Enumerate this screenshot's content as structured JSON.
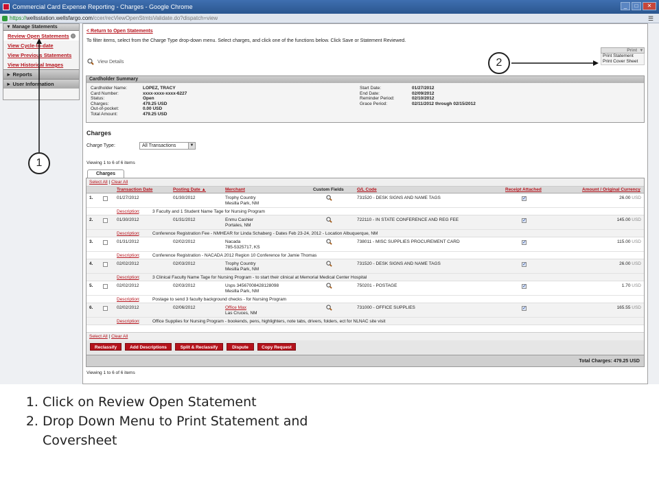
{
  "window": {
    "title": "Commercial Card Expense Reporting - Charges - Google Chrome",
    "min": "_",
    "max": "□",
    "close": "✕"
  },
  "address": {
    "scheme": "https://",
    "host": "wellsstation.wellsfargo.com",
    "path": "/ccer/recViewOpenStmtsValidate.do?dispatch=view"
  },
  "sidebar": {
    "section_title": "Manage Statements",
    "items": [
      {
        "label": "Review Open Statements"
      },
      {
        "label": "View Cycle-to-date"
      },
      {
        "label": "View Previous Statements"
      },
      {
        "label": "View Historical Images"
      }
    ],
    "reports": "Reports",
    "user_info": "User Information"
  },
  "main": {
    "back_link": "< Return to Open Statements",
    "instructions": "To filter items, select from the Charge Type drop-down menu. Select charges, and click one of the functions below. Click Save or Statement Reviewed.",
    "view_details": "View Details",
    "print": {
      "label": "Print",
      "options": [
        "Print Statement",
        "Print Cover Sheet"
      ]
    }
  },
  "summary": {
    "title": "Cardholder Summary",
    "left": [
      {
        "label": "Cardholder Name:",
        "value": "LOPEZ, TRACY"
      },
      {
        "label": "Card Number:",
        "value": "xxxx-xxxx-xxxx-6227"
      },
      {
        "label": "Status:",
        "value": "Open"
      },
      {
        "label": "Charges:",
        "value": "479.25 USD"
      },
      {
        "label": "Out-of-pocket:",
        "value": "0.00 USD"
      },
      {
        "label": "Total Amount:",
        "value": "479.25 USD"
      }
    ],
    "right": [
      {
        "label": "Start Date:",
        "value": "01/27/2012"
      },
      {
        "label": "End Date:",
        "value": "02/09/2012"
      },
      {
        "label": "Reminder Period:",
        "value": "02/10/2012"
      },
      {
        "label": "Grace Period:",
        "value": "02/11/2012  through  02/15/2012"
      }
    ]
  },
  "charges": {
    "heading": "Charges",
    "type_label": "Charge Type:",
    "type_value": "All Transactions",
    "viewing": "Viewing 1 to 6 of 6 items",
    "tab": "Charges",
    "select_all": "Select All",
    "clear_all": "Clear All",
    "columns": {
      "txn_date": "Transaction Date",
      "post_date": "Posting Date ▲",
      "merchant": "Merchant",
      "custom": "Custom Fields",
      "gl": "G/L Code",
      "receipt": "Receipt Attached",
      "amount": "Amount / Original Currency"
    },
    "desc_label": "Description",
    "rows": [
      {
        "num": "1.",
        "txn": "01/27/2012",
        "post": "01/30/2012",
        "merchant1": "Trophy Country",
        "merchant2": "Mesilla Park, NM",
        "gl": "731520 - DESK SIGNS AND NAME TAGS",
        "amount": "26.00",
        "currency": "USD",
        "description": "3 Faculty and 1 Student Name Tage for Nursing Program"
      },
      {
        "num": "2.",
        "txn": "01/30/2012",
        "post": "01/31/2012",
        "merchant1": "Enmu Cashier",
        "merchant2": "Portales, NM",
        "gl": "722110 - IN STATE CONFERENCE AND REG FEE",
        "amount": "145.00",
        "currency": "USD",
        "description": "Conference Registration Fee - NMHEAR for Linda Schaberg - Dates Feb 23-24, 2012 - Location Albuquerque, NM"
      },
      {
        "num": "3.",
        "txn": "01/31/2012",
        "post": "02/02/2012",
        "merchant1": "Nacada",
        "merchant2": "785-5325717, KS",
        "gl": "738011 - MISC SUPPLIES PROCUREMENT CARD",
        "amount": "115.00",
        "currency": "USD",
        "description": "Conference Registration - NACADA 2012 Region 10 Conference for Jamie Thomas"
      },
      {
        "num": "4.",
        "txn": "02/02/2012",
        "post": "02/03/2012",
        "merchant1": "Trophy Country",
        "merchant2": "Mesilla Park, NM",
        "gl": "731520 - DESK SIGNS AND NAME TAGS",
        "amount": "26.00",
        "currency": "USD",
        "description": "3 Clinical Faculty Name Tage for Nursing Program - to start their clinical at Memorial Medical Center Hospital"
      },
      {
        "num": "5.",
        "txn": "02/02/2012",
        "post": "02/03/2012",
        "merchant1": "Usps 34567008428128098",
        "merchant2": "Mesilla Park, NM",
        "gl": "750201 - POSTAGE",
        "amount": "1.70",
        "currency": "USD",
        "description": "Postage to send 3 faculty background checks - for Nursing Program"
      },
      {
        "num": "6.",
        "txn": "02/02/2012",
        "post": "02/06/2012",
        "merchant1": "Office Max",
        "merchant2": "Las Cruces, NM",
        "gl": "731000 - OFFICE SUPPLIES",
        "amount": "165.55",
        "currency": "USD",
        "description": "Office Supplies for Nursing Program - bookends, pens, highlighters, note tabs, drivers, folders, ect for NLNAC site visit"
      }
    ],
    "buttons": [
      "Reclassify",
      "Add Descriptions",
      "Split & Reclassify",
      "Dispute",
      "Copy Request"
    ],
    "total": "Total Charges: 479.25 USD",
    "viewing_bottom": "Viewing 1 to 6 of 6 items"
  },
  "callouts": {
    "one": "1",
    "two": "2"
  },
  "steps": [
    "Click on Review Open Statement",
    "Drop Down Menu to Print Statement and",
    "Coversheet"
  ]
}
